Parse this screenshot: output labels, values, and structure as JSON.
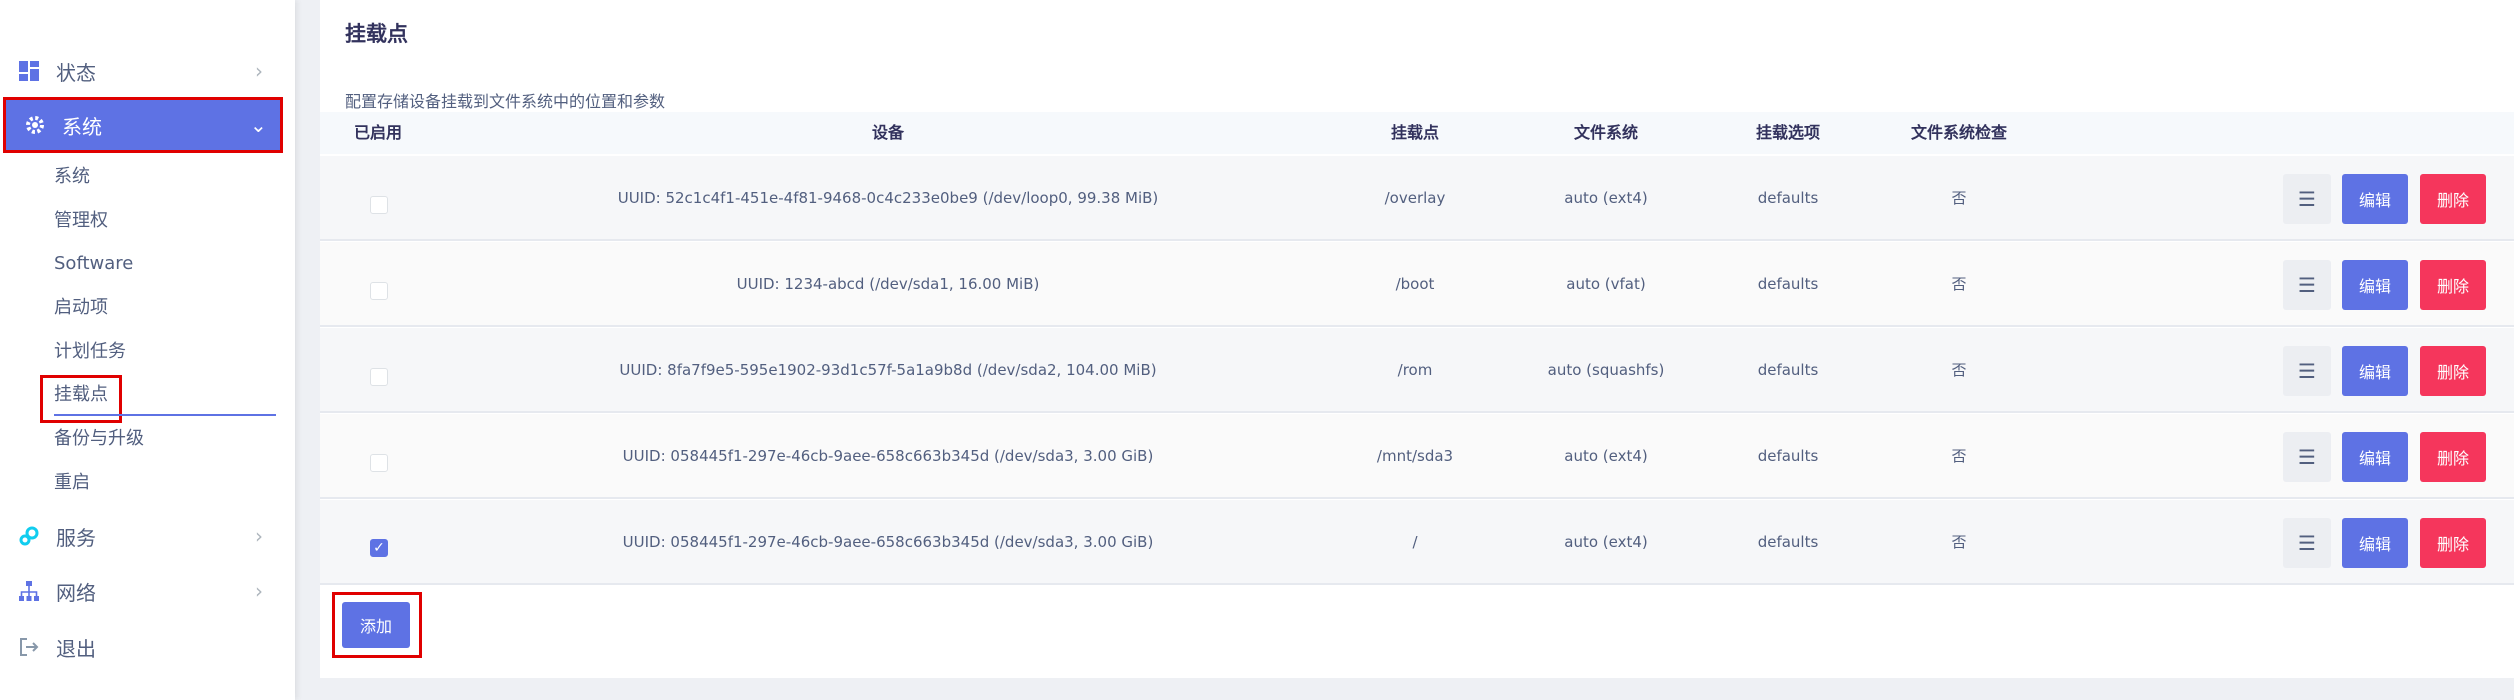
{
  "sidebar": {
    "menu": [
      {
        "label": "状态",
        "icon": "dashboard-icon"
      },
      {
        "label": "系统",
        "icon": "gear-icon"
      },
      {
        "label": "服务",
        "icon": "services-icon"
      },
      {
        "label": "网络",
        "icon": "network-icon"
      },
      {
        "label": "退出",
        "icon": "logout-icon"
      }
    ],
    "submenu": [
      "系统",
      "管理权",
      "Software",
      "启动项",
      "计划任务",
      "挂载点",
      "备份与升级",
      "重启"
    ]
  },
  "page": {
    "title": "挂载点",
    "description": "配置存储设备挂载到文件系统中的位置和参数"
  },
  "table": {
    "headers": [
      "已启用",
      "设备",
      "挂载点",
      "文件系统",
      "挂载选项",
      "文件系统检查"
    ],
    "rows": [
      {
        "enabled": false,
        "device": "UUID: 52c1c4f1-451e-4f81-9468-0c4c233e0be9 (/dev/loop0, 99.38 MiB)",
        "mount": "/overlay",
        "fs": "auto (ext4)",
        "options": "defaults",
        "check": "否"
      },
      {
        "enabled": false,
        "device": "UUID: 1234-abcd (/dev/sda1, 16.00 MiB)",
        "mount": "/boot",
        "fs": "auto (vfat)",
        "options": "defaults",
        "check": "否"
      },
      {
        "enabled": false,
        "device": "UUID: 8fa7f9e5-595e1902-93d1c57f-5a1a9b8d (/dev/sda2, 104.00 MiB)",
        "mount": "/rom",
        "fs": "auto (squashfs)",
        "options": "defaults",
        "check": "否"
      },
      {
        "enabled": false,
        "device": "UUID: 058445f1-297e-46cb-9aee-658c663b345d (/dev/sda3, 3.00 GiB)",
        "mount": "/mnt/sda3",
        "fs": "auto (ext4)",
        "options": "defaults",
        "check": "否"
      },
      {
        "enabled": true,
        "device": "UUID: 058445f1-297e-46cb-9aee-658c663b345d (/dev/sda3, 3.00 GiB)",
        "mount": "/",
        "fs": "auto (ext4)",
        "options": "defaults",
        "check": "否"
      }
    ],
    "actions": {
      "menu": "☰",
      "edit": "编辑",
      "delete": "删除"
    }
  },
  "add_button": "添加",
  "colors": {
    "accent": "#5e72e4",
    "danger": "#f5365c",
    "highlight": "#e00000"
  }
}
